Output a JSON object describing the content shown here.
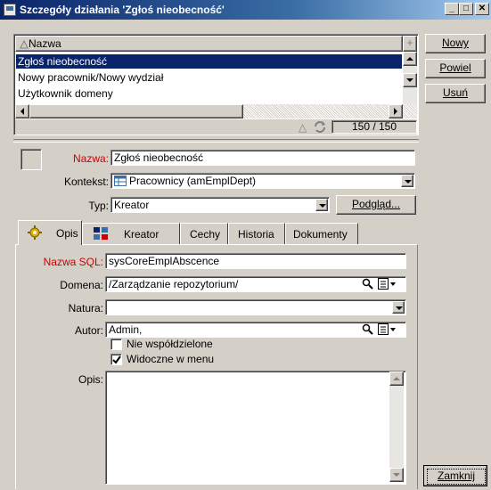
{
  "window": {
    "title": "Szczegóły działania 'Zgłoś nieobecność'",
    "controls": {
      "minimize": "_",
      "maximize": "□",
      "close": "✕"
    }
  },
  "list": {
    "column": "Nazwa",
    "rows": [
      "Zgłoś nieobecność",
      "Nowy pracownik/Nowy wydział",
      "Użytkownik domeny"
    ],
    "selected_index": 0,
    "counter": "150 / 150"
  },
  "side_buttons": {
    "new": "Nowy",
    "duplicate": "Powiel",
    "delete": "Usuń"
  },
  "form": {
    "name_label": "Nazwa:",
    "name_value": "Zgłoś nieobecność",
    "context_label": "Kontekst:",
    "context_value": "Pracownicy (amEmplDept)",
    "type_label": "Typ:",
    "type_value": "Kreator",
    "preview_button": "Podgląd..."
  },
  "tabs": [
    "Opis",
    "Kreator",
    "Cechy",
    "Historia",
    "Dokumenty"
  ],
  "tab_panel": {
    "sql_name_label": "Nazwa SQL:",
    "sql_name_value": "sysCoreEmplAbscence",
    "domain_label": "Domena:",
    "domain_value": "/Zarządzanie repozytorium/",
    "nature_label": "Natura:",
    "nature_value": "",
    "author_label": "Autor:",
    "author_value": "Admin,",
    "not_shared_label": "Nie współdzielone",
    "not_shared_checked": false,
    "visible_menu_label": "Widoczne w menu",
    "visible_menu_checked": true,
    "description_label": "Opis:",
    "description_value": ""
  },
  "close_button": "Zamknij",
  "colors": {
    "title_start": "#0a246a",
    "title_end": "#a6caf0",
    "selection": "#0a246a",
    "required_label": "#cc0000",
    "face": "#d4d0c8"
  },
  "icons": [
    "window-app-icon",
    "sort-ascending-icon",
    "refresh-icon",
    "table-icon",
    "gear-icon",
    "wizard-icon",
    "magnifier-icon",
    "list-picker-icon",
    "checkmark-icon"
  ]
}
